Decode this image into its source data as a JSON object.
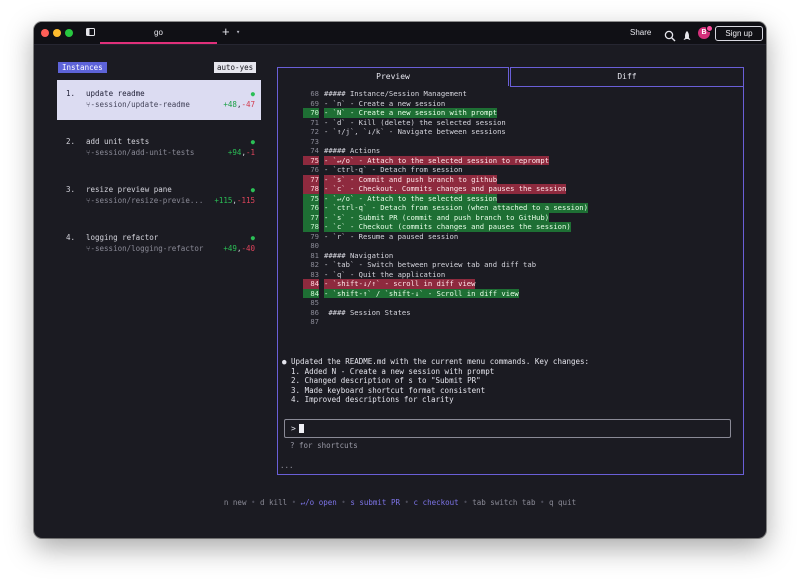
{
  "titlebar": {
    "tab_title": "go",
    "new_tab": "+",
    "new_tab_chevron": "▾",
    "share_label": "Share",
    "avatar_initial": "B",
    "signup_label": "Sign up"
  },
  "left": {
    "instances_label": "Instances",
    "autoyes_label": "auto-yes",
    "sessions": [
      {
        "num": "1.",
        "title": "update readme",
        "branch": "⑂-session/update-readme",
        "add": "+48",
        "del": "-47",
        "dot": "●"
      },
      {
        "num": "2.",
        "title": "add unit tests",
        "branch": "⑂-session/add-unit-tests",
        "add": "+94",
        "del": "-1",
        "dot": "●"
      },
      {
        "num": "3.",
        "title": "resize preview pane",
        "branch": "⑂-session/resize-previe...",
        "add": "+115",
        "del": "-115",
        "dot": "●"
      },
      {
        "num": "4.",
        "title": "logging refactor",
        "branch": "⑂-session/logging-refactor",
        "add": "+49",
        "del": "-40",
        "dot": "●"
      }
    ]
  },
  "right": {
    "tab_preview": "Preview",
    "tab_diff": "Diff",
    "code": [
      {
        "ln": "68",
        "type": "ctx",
        "text": "##### Instance/Session Management"
      },
      {
        "ln": "69",
        "type": "ctx",
        "text": "- `n` - Create a new session"
      },
      {
        "ln": "70",
        "type": "ad",
        "text": "- `N` - Create a new session with prompt"
      },
      {
        "ln": "71",
        "type": "ctx",
        "text": "- `d` - Kill (delete) the selected session"
      },
      {
        "ln": "72",
        "type": "ctx",
        "text": "- `↑/j`, `↓/k` - Navigate between sessions"
      },
      {
        "ln": "73",
        "type": "ctx",
        "text": ""
      },
      {
        "ln": "74",
        "type": "ctx",
        "text": "##### Actions"
      },
      {
        "ln": "75",
        "type": "rm",
        "text": "- `↵/o` - Attach to the selected session to reprompt"
      },
      {
        "ln": "76",
        "type": "ctx",
        "text": "- `ctrl-q` - Detach from session"
      },
      {
        "ln": "77",
        "type": "rm",
        "text": "- `s` - Commit and push branch to github"
      },
      {
        "ln": "78",
        "type": "rm",
        "text": "- `c` - Checkout. Commits changes and pauses the session"
      },
      {
        "ln": "75",
        "type": "ad",
        "text": "- `↵/o` - Attach to the selected session"
      },
      {
        "ln": "76",
        "type": "ad",
        "text": "- `ctrl-q` - Detach from session (when attached to a session)"
      },
      {
        "ln": "77",
        "type": "ad",
        "text": "- `s` - Submit PR (commit and push branch to GitHub)"
      },
      {
        "ln": "78",
        "type": "ad",
        "text": "- `c` - Checkout (commits changes and pauses the session)"
      },
      {
        "ln": "79",
        "type": "ctx",
        "text": "- `r` - Resume a paused session"
      },
      {
        "ln": "80",
        "type": "ctx",
        "text": ""
      },
      {
        "ln": "81",
        "type": "ctx",
        "text": "##### Navigation"
      },
      {
        "ln": "82",
        "type": "ctx",
        "text": "- `tab` - Switch between preview tab and diff tab"
      },
      {
        "ln": "83",
        "type": "ctx",
        "text": "- `q` - Quit the application"
      },
      {
        "ln": "84",
        "type": "rm",
        "text": "- `shift-↓/↑` - scroll in diff view"
      },
      {
        "ln": "84",
        "type": "ad",
        "text": "- `shift-↑` / `shift-↓` - Scroll in diff view"
      },
      {
        "ln": "85",
        "type": "ctx",
        "text": ""
      },
      {
        "ln": "86",
        "type": "ctx",
        "text": " #### Session States"
      },
      {
        "ln": "87",
        "type": "ctx",
        "text": ""
      }
    ],
    "summary": [
      "● Updated the README.md with the current menu commands. Key changes:",
      "  1. Added N - Create a new session with prompt",
      "  2. Changed description of s to \"Submit PR\"",
      "  3. Made keyboard shortcut format consistent",
      "  4. Improved descriptions for clarity"
    ],
    "prompt_symbol": ">",
    "shortcuts_hint": "? for shortcuts",
    "ellipsis": "..."
  },
  "footer": [
    {
      "text": "n new",
      "accent": false
    },
    {
      "text": "d kill",
      "accent": false
    },
    {
      "text": "↵/o open",
      "accent": true
    },
    {
      "text": "s submit PR",
      "accent": true
    },
    {
      "text": "c checkout",
      "accent": true
    },
    {
      "text": "tab switch tab",
      "accent": false
    },
    {
      "text": "q quit",
      "accent": false
    }
  ],
  "colors": {
    "accent": "#6a5fd8",
    "add": "#2bbf56",
    "remove": "#e0445c",
    "brand_pink": "#e0307a"
  }
}
